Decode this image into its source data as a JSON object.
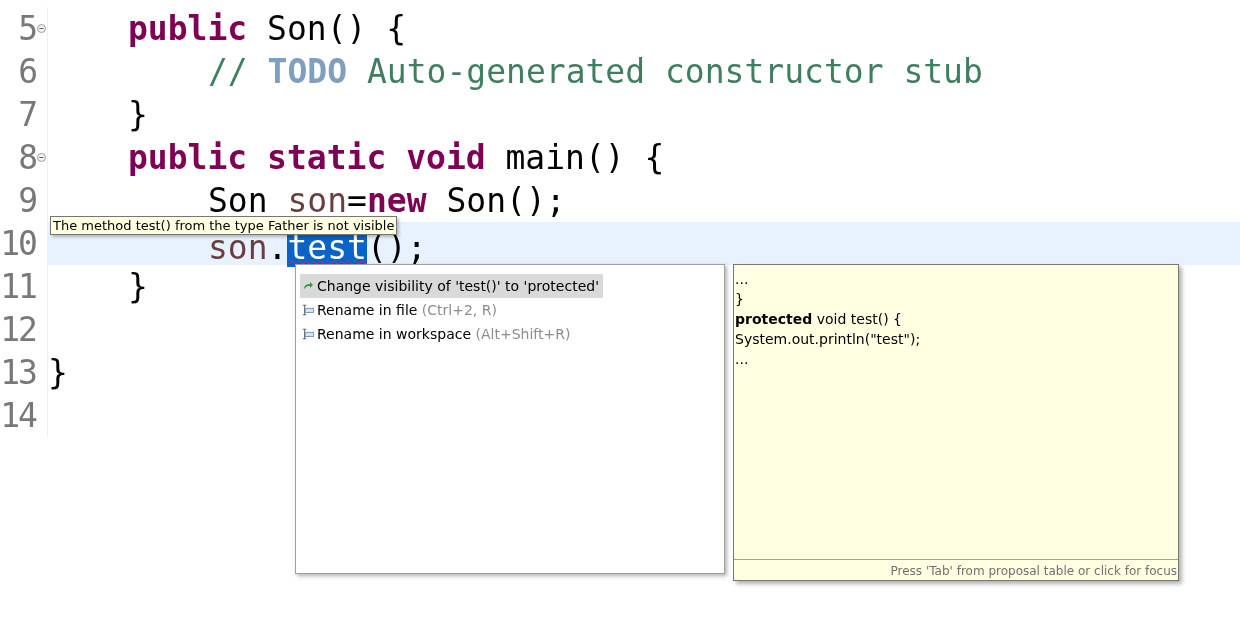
{
  "editor": {
    "lines": [
      {
        "number": "5",
        "fold_marker": true,
        "current": false,
        "kind": "member",
        "tokens": [
          {
            "text": "public",
            "kind": "keyword"
          },
          {
            "text": " Son() {",
            "kind": "plain"
          }
        ]
      },
      {
        "number": "6",
        "fold_marker": false,
        "current": false,
        "kind": "body",
        "tokens": [
          {
            "text": "// ",
            "kind": "comment"
          },
          {
            "text": "TODO",
            "kind": "todo"
          },
          {
            "text": " Auto-generated constructor stub",
            "kind": "comment"
          }
        ]
      },
      {
        "number": "7",
        "fold_marker": false,
        "current": false,
        "kind": "member",
        "tokens": [
          {
            "text": "}",
            "kind": "plain"
          }
        ]
      },
      {
        "number": "8",
        "fold_marker": true,
        "current": false,
        "kind": "member",
        "tokens": [
          {
            "text": "public static void",
            "kind": "keyword"
          },
          {
            "text": " main() {",
            "kind": "plain"
          }
        ]
      },
      {
        "number": "9",
        "fold_marker": false,
        "current": false,
        "kind": "body",
        "tokens": [
          {
            "text": "Son ",
            "kind": "plain"
          },
          {
            "text": "son",
            "kind": "variable"
          },
          {
            "text": "=",
            "kind": "plain"
          },
          {
            "text": "new",
            "kind": "keyword"
          },
          {
            "text": " Son();",
            "kind": "plain"
          }
        ]
      },
      {
        "number": "10",
        "fold_marker": false,
        "current": true,
        "kind": "body",
        "tokens": [
          {
            "text": "son",
            "kind": "variable"
          },
          {
            "text": ".",
            "kind": "plain"
          },
          {
            "text": "test",
            "kind": "selected"
          },
          {
            "text": "();",
            "kind": "plain"
          }
        ]
      },
      {
        "number": "11",
        "fold_marker": false,
        "current": false,
        "kind": "member",
        "tokens": [
          {
            "text": "}",
            "kind": "plain"
          }
        ]
      },
      {
        "number": "12",
        "fold_marker": false,
        "current": false,
        "kind": "top"
      },
      {
        "number": "13",
        "fold_marker": false,
        "current": false,
        "kind": "top",
        "tokens": [
          {
            "text": "}",
            "kind": "plain"
          }
        ]
      },
      {
        "number": "14",
        "fold_marker": false,
        "current": false,
        "kind": "top"
      }
    ]
  },
  "error_tooltip": {
    "text": "The method test() from the type Father is not visible"
  },
  "quick_fix": {
    "proposals": [
      {
        "label": "Change visibility of 'test()' to 'protected'",
        "kind": "change",
        "selected": true
      },
      {
        "label": "Rename in file",
        "shortcut": "(Ctrl+2, R)",
        "kind": "rename",
        "selected": false
      },
      {
        "label": "Rename in workspace",
        "shortcut": "(Alt+Shift+R)",
        "kind": "rename",
        "selected": false
      }
    ]
  },
  "preview": {
    "lines": [
      "...",
      "}",
      "**protected** void test() {",
      "System.out.println(\"test\");",
      "..."
    ],
    "footer": "Press 'Tab' from proposal table or click for focus"
  }
}
